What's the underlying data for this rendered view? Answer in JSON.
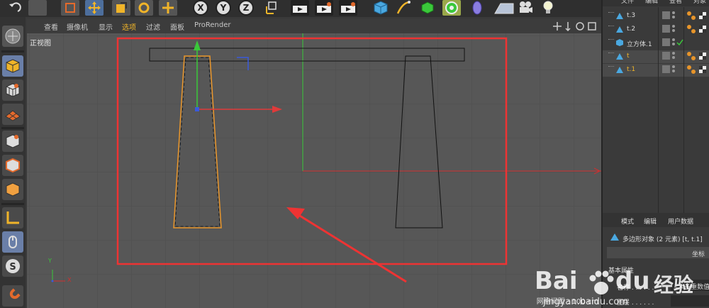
{
  "toolbar": {
    "axis_x": "X",
    "axis_y": "Y",
    "axis_z": "Z"
  },
  "viewport": {
    "menu": [
      "查看",
      "摄像机",
      "显示",
      "选项",
      "过滤",
      "面板",
      "ProRender"
    ],
    "active_menu_index": 3,
    "label": "正视图",
    "grid_spacing": "网格间距 : 100 cm",
    "axis_label_y": "Y",
    "axis_label_x": "X"
  },
  "object_manager": {
    "menu": [
      "文件",
      "编辑",
      "查看",
      "对象"
    ],
    "objects": [
      {
        "name": "t.3",
        "type": "polygon"
      },
      {
        "name": "t.2",
        "type": "polygon"
      },
      {
        "name": "立方体.1",
        "type": "cube"
      },
      {
        "name": "t",
        "type": "polygon"
      },
      {
        "name": "t.1",
        "type": "polygon"
      }
    ]
  },
  "attributes": {
    "menu": [
      "模式",
      "编辑",
      "用户数据"
    ],
    "title": "多边形对象 (2 元素) [t, t.1]",
    "tab_coords": "坐标",
    "section": "基本属性",
    "field_name_label": "名称 . . . . . .",
    "field_name_value": "<<多重数值>>",
    "field_layer_label": "图层 . . . . . ."
  },
  "watermark": {
    "brand": "Bai",
    "brand2": "du",
    "cn": "经验",
    "url": "jingyan.baidu.com"
  },
  "colors": {
    "selection": "#e8952a",
    "annotation": "#ee3333",
    "axis_x": "#e03a3a",
    "axis_y": "#3ac83a",
    "axis_z": "#3a5adc",
    "viewport_bg": "#575757"
  }
}
